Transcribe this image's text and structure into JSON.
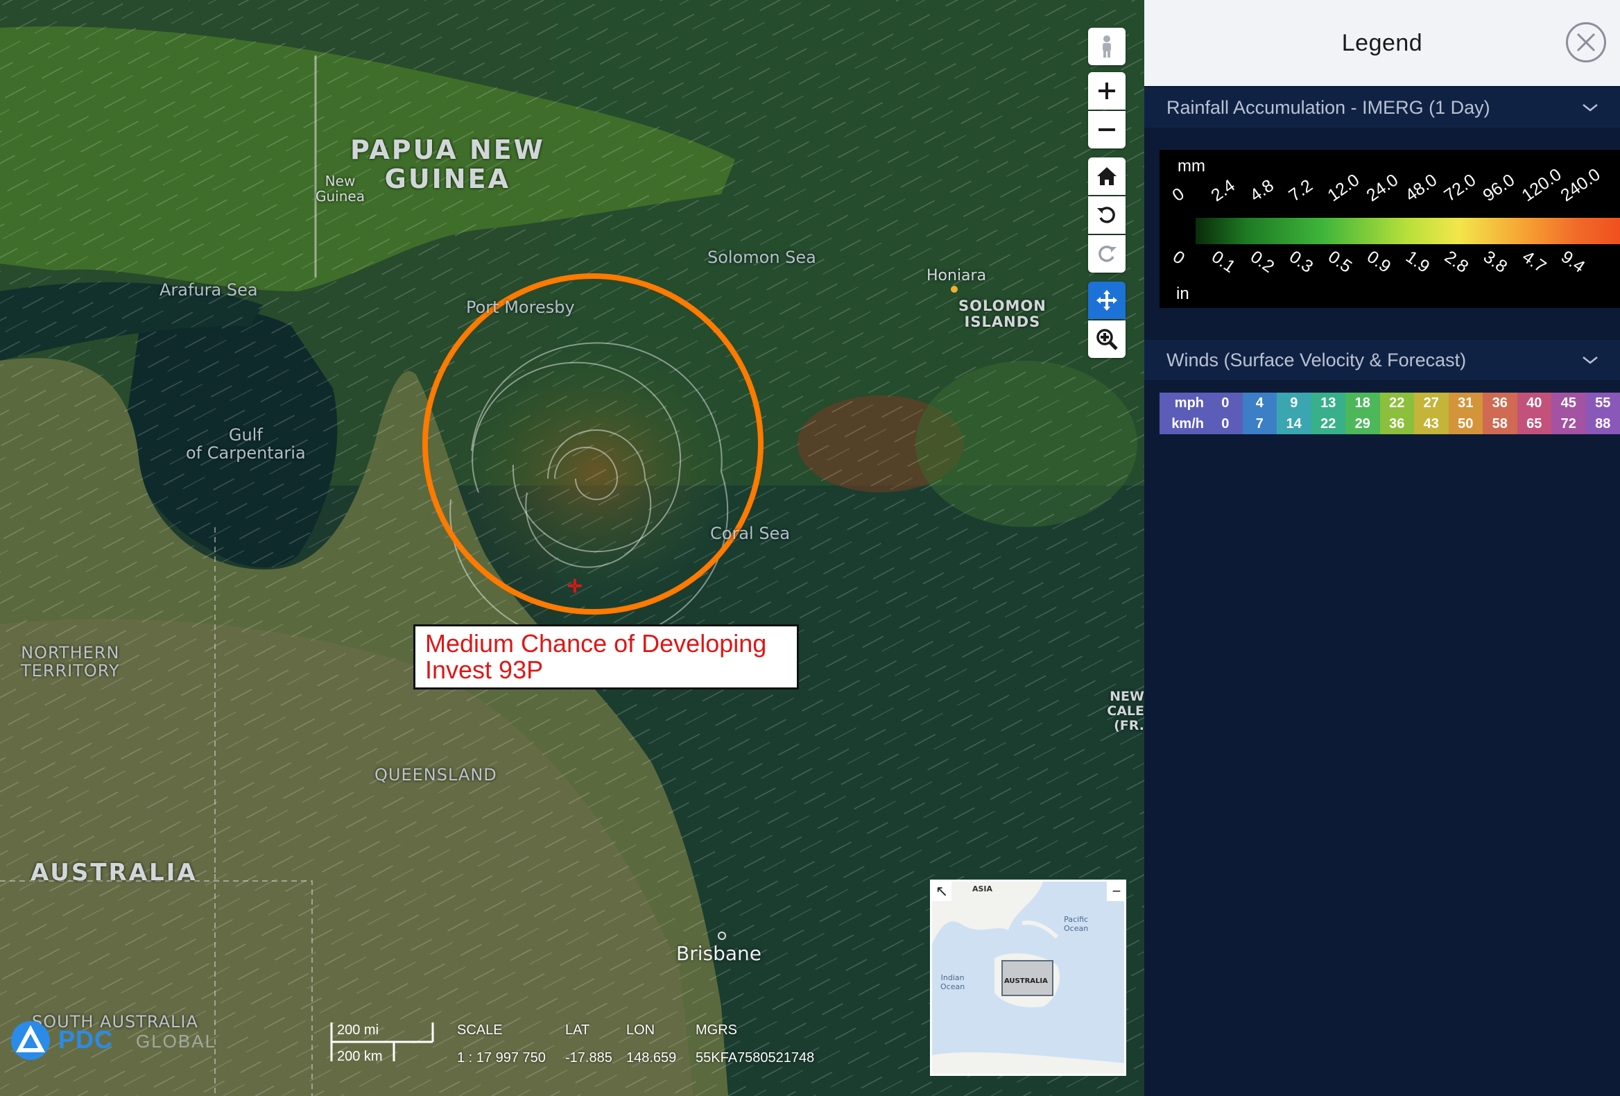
{
  "map": {
    "places": {
      "papua_new_guinea": "PAPUA NEW\nGUINEA",
      "new_guinea": "New\nGuinea",
      "arafura_sea": "Arafura Sea",
      "port_moresby": "Port Moresby",
      "solomon_sea": "Solomon Sea",
      "honiara": "Honiara",
      "solomon_islands": "SOLOMON\nISLANDS",
      "gulf_of_carpentaria": "Gulf\nof Carpentaria",
      "coral_sea": "Coral Sea",
      "northern_territory": "NORTHERN\nTERRITORY",
      "queensland": "QUEENSLAND",
      "australia": "AUSTRALIA",
      "new_caledonia": "NEW CALE\n(FR.",
      "brisbane": "Brisbane",
      "south_australia": "SOUTH AUSTRALIA"
    },
    "annotation": {
      "line1": "Medium Chance of Developing",
      "line2": "Invest 93P",
      "circle_color": "#ff7a00",
      "text_color": "#e01616"
    },
    "toolbar_icons": [
      "street-view-icon",
      "zoom-in-icon",
      "zoom-out-icon",
      "home-icon",
      "rotate-left-icon",
      "rotate-right-icon",
      "pan-icon",
      "zoom-box-icon"
    ],
    "active_tool": "pan-icon",
    "overview": {
      "asia": "ASIA",
      "pacific": "Pacific\nOcean",
      "indian": "Indian\nOcean",
      "australia": "AUSTRALIA",
      "collapse": "−",
      "expand": "↖"
    },
    "scale": {
      "mi": "200 mi",
      "km": "200 km"
    },
    "readout": {
      "scale_label": "SCALE",
      "scale_value": "1 : 17 997 750",
      "lat_label": "LAT",
      "lat_value": "-17.885",
      "lon_label": "LON",
      "lon_value": "148.659",
      "mgrs_label": "MGRS",
      "mgrs_value": "55KFA7580521748"
    },
    "logo": {
      "name": "PDC",
      "sub": "GLOBAL"
    }
  },
  "legend": {
    "title": "Legend",
    "close_icon": "close-icon",
    "rainfall": {
      "heading": "Rainfall Accumulation - IMERG (1 Day)",
      "unit_top": "mm",
      "unit_bottom": "in",
      "mm_ticks": [
        "0",
        "2.4",
        "4.8",
        "7.2",
        "12.0",
        "24.0",
        "48.0",
        "72.0",
        "96.0",
        "120.0",
        "240.0"
      ],
      "in_ticks": [
        "0",
        "0.1",
        "0.2",
        "0.3",
        "0.5",
        "0.9",
        "1.9",
        "2.8",
        "3.8",
        "4.7",
        "9.4"
      ]
    },
    "winds": {
      "heading": "Winds (Surface Velocity & Forecast)",
      "mph_label": "mph",
      "kmh_label": "km/h",
      "mph": [
        "0",
        "4",
        "9",
        "13",
        "18",
        "22",
        "27",
        "31",
        "36",
        "40",
        "45",
        "55"
      ],
      "kmh": [
        "0",
        "7",
        "14",
        "22",
        "29",
        "36",
        "43",
        "50",
        "58",
        "65",
        "72",
        "88"
      ],
      "colors": [
        "#5c5db8",
        "#3c7fc6",
        "#3aa6b0",
        "#38b08a",
        "#4cb85a",
        "#8cbf3c",
        "#c4b43a",
        "#d4943a",
        "#d06a52",
        "#c2527a",
        "#a452a2",
        "#8a58b8"
      ]
    }
  }
}
